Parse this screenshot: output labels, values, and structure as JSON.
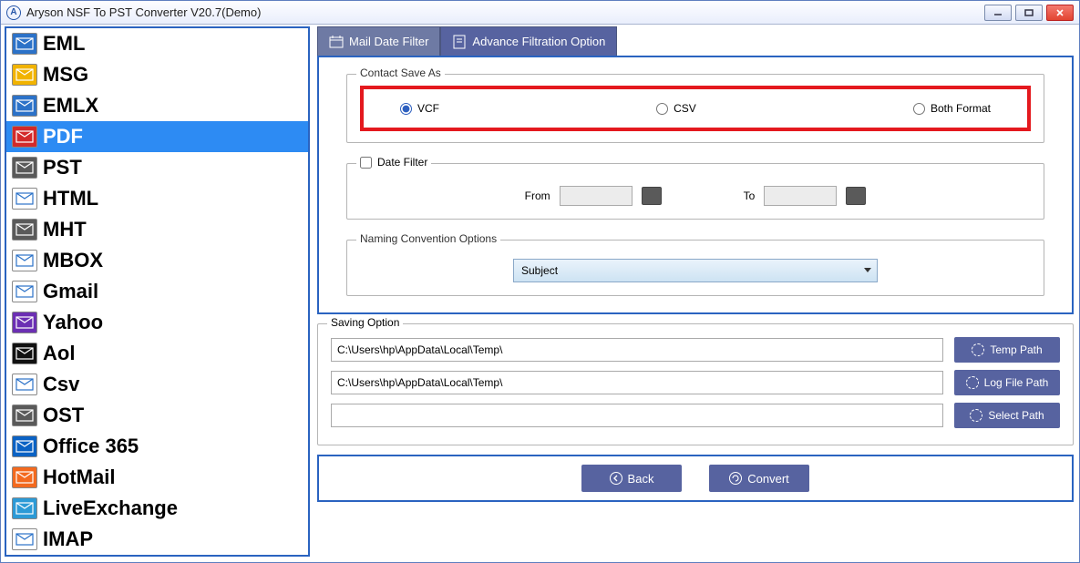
{
  "window": {
    "title": "Aryson NSF To PST Converter V20.7(Demo)"
  },
  "sidebar": {
    "items": [
      {
        "label": "EML",
        "bg": "#2c72c8"
      },
      {
        "label": "MSG",
        "bg": "#f1b300"
      },
      {
        "label": "EMLX",
        "bg": "#2c72c8"
      },
      {
        "label": "PDF",
        "bg": "#d32a2a"
      },
      {
        "label": "PST",
        "bg": "#5a5a5a"
      },
      {
        "label": "HTML",
        "bg": "#ffffff"
      },
      {
        "label": "MHT",
        "bg": "#5a5a5a"
      },
      {
        "label": "MBOX",
        "bg": "#ffffff"
      },
      {
        "label": "Gmail",
        "bg": "#ffffff"
      },
      {
        "label": "Yahoo",
        "bg": "#6b2fb3"
      },
      {
        "label": "Aol",
        "bg": "#111111"
      },
      {
        "label": "Csv",
        "bg": "#ffffff"
      },
      {
        "label": "OST",
        "bg": "#5a5a5a"
      },
      {
        "label": "Office 365",
        "bg": "#0b62c4"
      },
      {
        "label": "HotMail",
        "bg": "#f36a1f"
      },
      {
        "label": "LiveExchange",
        "bg": "#2c9ad6"
      },
      {
        "label": "IMAP",
        "bg": "#ffffff"
      }
    ],
    "selected_index": 3
  },
  "tabs": {
    "mail_date_filter": "Mail Date Filter",
    "advance_filtration": "Advance Filtration Option"
  },
  "contact_save_as": {
    "legend": "Contact Save As",
    "vcf": "VCF",
    "csv": "CSV",
    "both": "Both Format",
    "selected": "vcf"
  },
  "date_filter": {
    "legend": "Date Filter",
    "from": "From",
    "to": "To"
  },
  "naming": {
    "legend": "Naming Convention Options",
    "selected": "Subject"
  },
  "saving": {
    "legend": "Saving Option",
    "path1": "C:\\Users\\hp\\AppData\\Local\\Temp\\",
    "path2": "C:\\Users\\hp\\AppData\\Local\\Temp\\",
    "path3": "",
    "temp_btn": "Temp Path",
    "log_btn": "Log File Path",
    "select_btn": "Select Path"
  },
  "buttons": {
    "back": "Back",
    "convert": "Convert"
  }
}
